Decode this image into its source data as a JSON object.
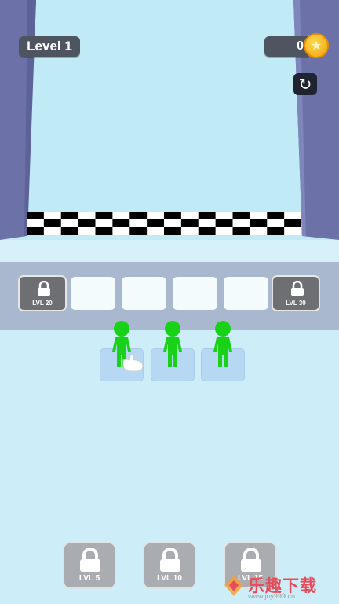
{
  "hud": {
    "level_label": "Level 1",
    "coin_count": "0",
    "coin_icon": "coin-icon",
    "restart_icon": "restart-icon"
  },
  "merge_row": {
    "left_lock_label": "LVL 20",
    "right_lock_label": "LVL 30",
    "empty_slots": 4
  },
  "units": {
    "count": 3,
    "color": "#18d118"
  },
  "bottom_locks": [
    {
      "label": "LVL 5"
    },
    {
      "label": "LVL 10"
    },
    {
      "label": "LVL 15"
    }
  ],
  "watermark": {
    "text": "乐趣下载",
    "url": "www.joy999.cn"
  },
  "colors": {
    "background": "#cdeef8",
    "wall": "#6c72a8",
    "track": "#bfeaf6",
    "tray": "#a9b8cf",
    "unit_green": "#18d118"
  }
}
